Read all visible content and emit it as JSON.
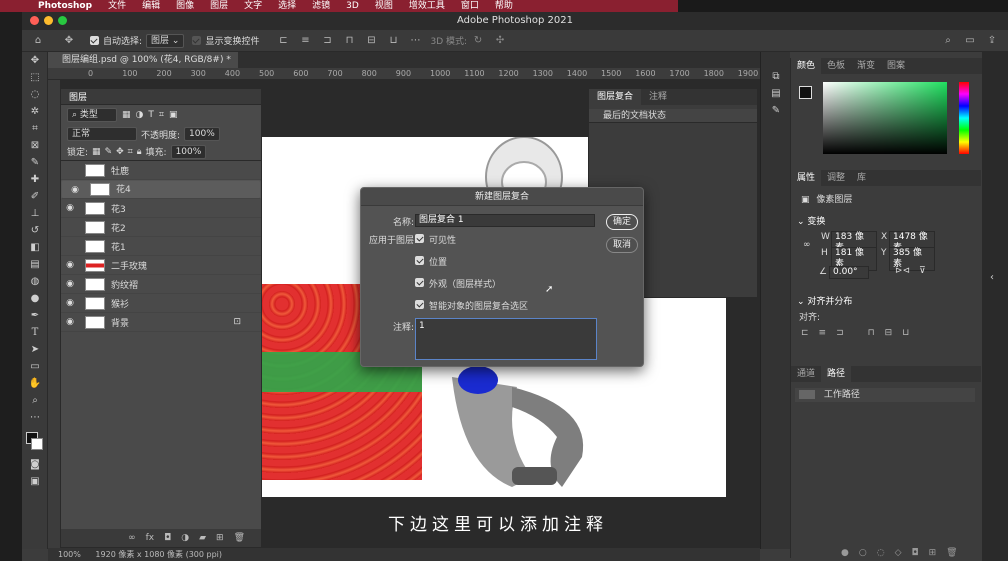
{
  "menubar": {
    "items": [
      "Photoshop",
      "文件",
      "编辑",
      "图像",
      "图层",
      "文字",
      "选择",
      "滤镜",
      "3D",
      "视图",
      "增效工具",
      "窗口",
      "帮助"
    ]
  },
  "window": {
    "title": "Adobe Photoshop 2021"
  },
  "options_bar": {
    "auto_select_label": "自动选择:",
    "auto_select_value": "图层",
    "show_transform_label": "显示变换控件",
    "mode_3d_label": "3D 模式:"
  },
  "document": {
    "tab_title": "图层编组.psd @ 100% (花4, RGB/8#) *",
    "ruler_ticks": [
      "0",
      "100",
      "200",
      "300",
      "400",
      "500",
      "600",
      "700",
      "800",
      "900",
      "1000",
      "1100",
      "1200",
      "1300",
      "1400",
      "1500",
      "1600",
      "1700",
      "1800",
      "1900"
    ],
    "caption": "下边这里可以添加注释"
  },
  "status_bar": {
    "zoom": "100%",
    "doc_info": "1920 像素 x 1080 像素 (300 ppi)"
  },
  "layers_panel": {
    "title": "图层",
    "filter_label": "类型",
    "blend_mode": "正常",
    "opacity_label": "不透明度:",
    "opacity_value": "100%",
    "lock_label": "锁定:",
    "fill_label": "填充:",
    "fill_value": "100%",
    "layers": [
      {
        "name": "牡鹿",
        "visible": false,
        "selected": false
      },
      {
        "name": "花4",
        "visible": true,
        "selected": true
      },
      {
        "name": "花3",
        "visible": true,
        "selected": false
      },
      {
        "name": "花2",
        "visible": false,
        "selected": false
      },
      {
        "name": "花1",
        "visible": false,
        "selected": false
      },
      {
        "name": "二手玫瑰",
        "visible": true,
        "selected": false
      },
      {
        "name": "豹纹褶",
        "visible": true,
        "selected": false
      },
      {
        "name": "猴衫",
        "visible": true,
        "selected": false
      },
      {
        "name": "背景",
        "visible": true,
        "selected": false
      }
    ]
  },
  "comps_panel": {
    "tab_comps": "图层复合",
    "tab_notes": "注释",
    "last_state": "最后的文档状态"
  },
  "dialog": {
    "title": "新建图层复合",
    "name_label": "名称:",
    "name_value": "图层复合 1",
    "apply_label": "应用于图层:",
    "options": [
      "可见性",
      "位置",
      "外观（图层样式）",
      "智能对象的图层复合选区"
    ],
    "comment_label": "注释:",
    "comment_value": "1",
    "ok_label": "确定",
    "cancel_label": "取消"
  },
  "right_panel": {
    "color_tabs": [
      "颜色",
      "色板",
      "渐变",
      "图案"
    ],
    "props_tabs": [
      "属性",
      "调整",
      "库"
    ],
    "pixel_layer": "像素图层",
    "transform_label": "变换",
    "w_label": "W",
    "w_value": "183 像素",
    "x_label": "X",
    "x_value": "1478 像素",
    "h_label": "H",
    "h_value": "181 像素",
    "y_label": "Y",
    "y_value": "385 像素",
    "angle_value": "0.00°",
    "align_label": "对齐并分布",
    "align_sub": "对齐:",
    "paths_tabs": [
      "通道",
      "路径"
    ],
    "work_path": "工作路径"
  }
}
